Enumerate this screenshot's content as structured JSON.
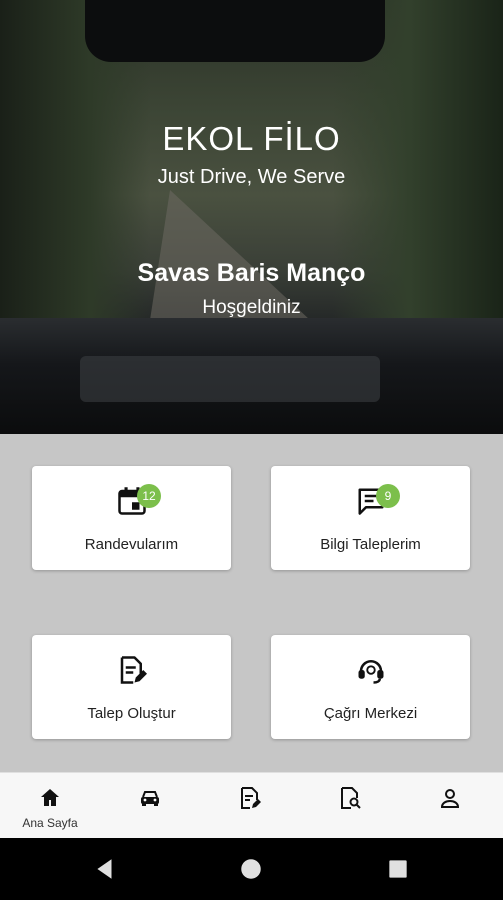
{
  "hero": {
    "brand_title": "EKOL FİLO",
    "brand_subtitle": "Just Drive, We Serve",
    "user_name": "Savas Baris Manço",
    "welcome": "Hoşgeldiniz"
  },
  "cards": [
    {
      "label": "Randevularım",
      "icon": "calendar-icon",
      "badge": "12"
    },
    {
      "label": "Bilgi Taleplerim",
      "icon": "message-icon",
      "badge": "9"
    },
    {
      "label": "Talep Oluştur",
      "icon": "edit-document-icon"
    },
    {
      "label": "Çağrı Merkezi",
      "icon": "headset-icon"
    }
  ],
  "bottom_nav": [
    {
      "label": "Ana Sayfa",
      "icon": "home-icon"
    },
    {
      "icon": "car-icon"
    },
    {
      "icon": "document-edit-icon"
    },
    {
      "icon": "document-search-icon"
    },
    {
      "icon": "user-icon"
    }
  ],
  "system_nav": [
    "back-icon",
    "home-circle-icon",
    "recents-icon"
  ],
  "colors": {
    "badge": "#7cbf4b",
    "content_bg": "#c6c6c6"
  }
}
